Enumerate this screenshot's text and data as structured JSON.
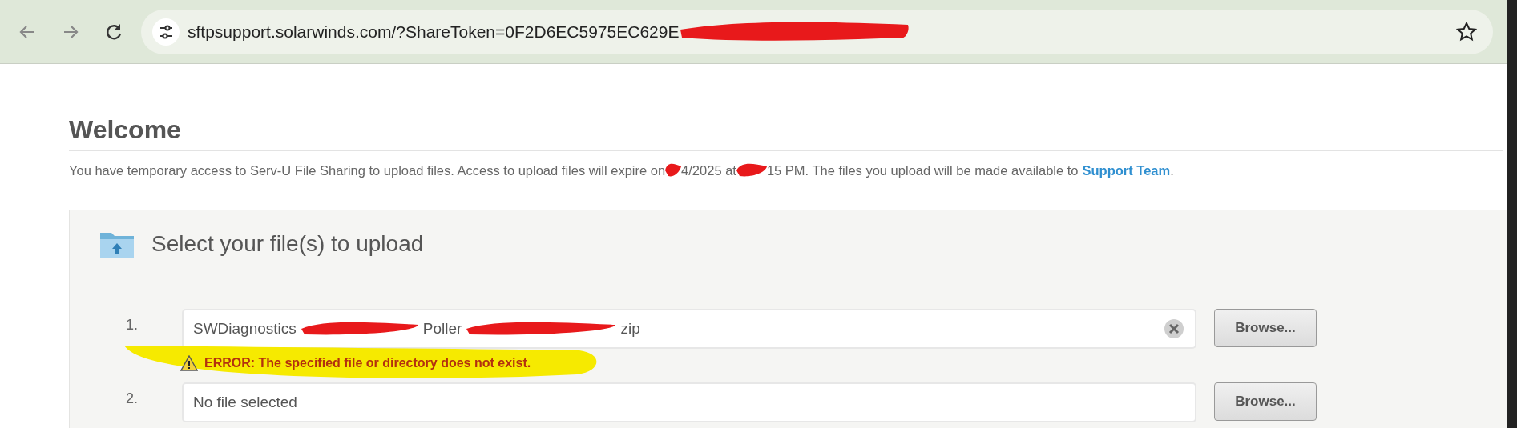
{
  "browser": {
    "url_parts": [
      "sftpsupport.solarwinds.com/?ShareToken=0F2D6EC5975EC629E"
    ]
  },
  "page": {
    "title": "Welcome",
    "notice": {
      "segments": [
        "You have temporary access to Serv-U File Sharing to upload files. Access to upload files will expire on",
        "4/2025 at",
        "15 PM. The files you upload will be made available to"
      ],
      "link": "Support Team",
      "end": "."
    },
    "upload": {
      "heading": "Select your file(s) to upload",
      "rows": [
        {
          "number": "1.",
          "value_parts": [
            "SWDiagnostics",
            "Poller",
            "zip"
          ],
          "clearable": true,
          "error": "ERROR: The specified file or directory does not exist.",
          "button": "Browse..."
        },
        {
          "number": "2.",
          "placeholder": "No file selected",
          "clearable": false,
          "button": "Browse..."
        }
      ]
    }
  }
}
